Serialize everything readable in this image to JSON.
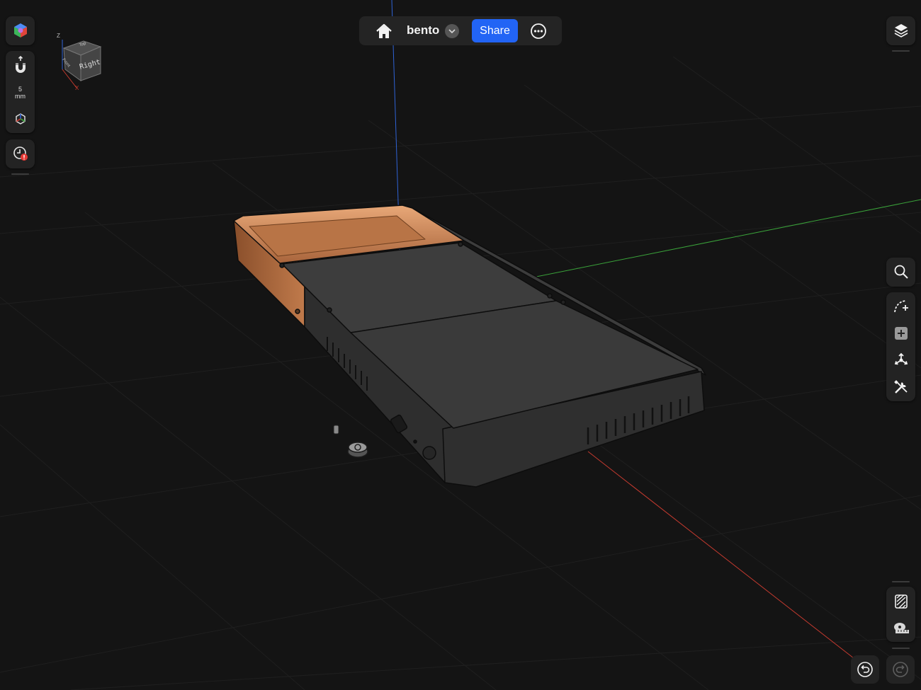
{
  "document": {
    "title": "bento",
    "share_label": "Share"
  },
  "left_toolbar": {
    "snap_value": "5",
    "snap_unit": "mm"
  },
  "view_cube": {
    "face_label": "Right",
    "side_label": "Front",
    "top_label": "Top",
    "axis_z": "Z",
    "axis_x": "X"
  },
  "icons": {
    "home": "home-icon",
    "dropdown": "chevron-down-icon",
    "more": "ellipsis-circle-icon",
    "render_mode": "color-cube-icon",
    "magnet": "magnet-icon",
    "axes": "axes-icon",
    "history": "history-clock-icon",
    "layers": "layers-icon",
    "search": "search-icon",
    "sketch": "sketch-curve-icon",
    "add_body": "add-body-icon",
    "transform": "transform-icon",
    "tools": "wrench-screwdriver-icon",
    "section": "section-view-icon",
    "measure": "measure-tape-icon",
    "undo": "undo-icon",
    "redo": "redo-icon"
  },
  "colors": {
    "accent": "#2264f5",
    "panel": "#232323",
    "background": "#141414",
    "model_body": "#3a3a3a",
    "model_interior": "#d08a5a",
    "axis_x": "#c43a2f",
    "axis_y": "#3aa23a",
    "axis_z": "#2f63d6",
    "warning_badge": "#e53935"
  }
}
